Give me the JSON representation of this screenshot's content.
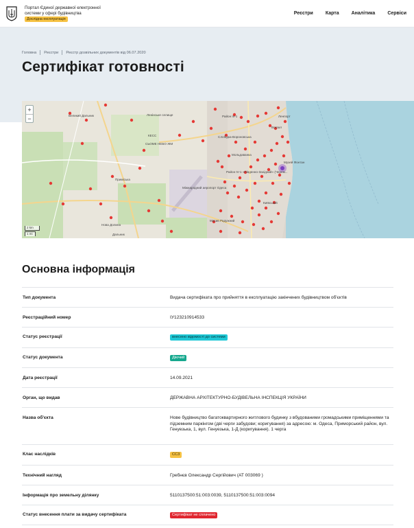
{
  "header": {
    "portal_title": "Портал Єдиної державної електронної системи у сфері будівництва",
    "pilot_badge": "Дослідна експлуатація",
    "nav": [
      "Реєстри",
      "Карта",
      "Аналітика",
      "Сервіси"
    ]
  },
  "breadcrumb": [
    "Головна",
    "Реєстри",
    "Реєстр дозвільних документів від 06.07.2020"
  ],
  "page_title": "Сертифікат готовності",
  "map": {
    "zoom_in": "+",
    "zoom_out": "−",
    "scale_km": "2 km",
    "scale_mi": "1 mi",
    "labels": [
      "Великий Дальник",
      "Ленінське селище",
      "КЕСС",
      "СЬОМЕ НЕБО ЖМ",
      "Приміська",
      "Район IV-1 «Південно-Західний» (Черем...",
      "Слобідка-Вороновська",
      "Район III-1",
      "Мольдаванка",
      "Ленпорт",
      "Вокзал",
      "Музей Фонтан",
      "Міжнародний аеропорт Одеса",
      "Київський",
      "Масив Радужний",
      "Нова Долина",
      "Дальник"
    ]
  },
  "info": {
    "title": "Основна інформація",
    "rows": [
      {
        "label": "Тип документа",
        "value": "Видача сертифіката про прийняття в експлуатацію закінчених будівництвом об'єктів"
      },
      {
        "label": "Реєстраційний номер",
        "value": "ІУ123210914533"
      },
      {
        "label": "Статус реєстрації",
        "tag": "внесено відомості до системи",
        "tag_color": "#1ec8d6"
      },
      {
        "label": "Статус документа",
        "tag": "Діючий",
        "tag_color": "#16a88e"
      },
      {
        "label": "Дата реєстрації",
        "value": "14.09.2021"
      },
      {
        "label": "Орган, що видав",
        "value": "ДЕРЖАВНА АРХІТЕКТУРНО-БУДІВЕЛЬНА ІНСПЕКЦІЯ УКРАЇНИ"
      },
      {
        "label": "Назва об'єкта",
        "value": "Нове будівництво багатоквартирного житлового будинку з вбудованими громадськими приміщеннями та підземним паркінгом (дві черги забудови; коригування) за адресою: м. Одеса, Приморський район, вул. Генуезька, 1, вул. Генуезька, 1-Д (коригування). 1 черга"
      },
      {
        "label": "Клас наслідків",
        "tag": "СС3",
        "tag_color": "#f6c243"
      },
      {
        "label": "Технічний нагляд",
        "value": "Гребнєв Олександр Сергійович (АТ 003069 )"
      },
      {
        "label": "Інформація про земельну ділянку",
        "value": "5110137500:51:003:0039, 5110137500:51:003:0094"
      },
      {
        "label": "Статус внесення плати за видачу сертифіката",
        "tag": "Сертифікат не сплачено",
        "tag_color": "#e0262f"
      }
    ]
  }
}
